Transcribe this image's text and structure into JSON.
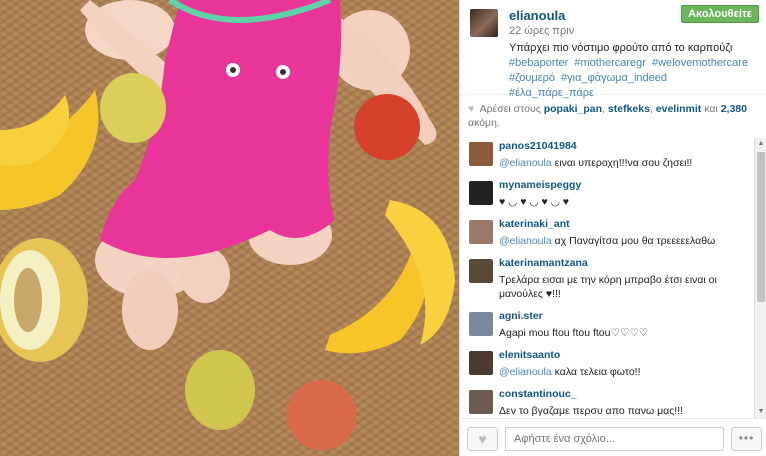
{
  "post": {
    "username": "elianoula",
    "time": "22 ώρες πριν",
    "follow_label": "Ακολουθείτε",
    "caption_text": "Υπάρχει πιο νόστιμο φρούτο από το καρπούζι",
    "hashtags": [
      "#bebaporter",
      "#mothercaregr",
      "#welovemothercare",
      "#ζουμερό",
      "#για_φάγωμα_indeed",
      "#έλα_πάρε_πάρε"
    ]
  },
  "likes": {
    "prefix": "Αρέσει στους",
    "users": [
      "popaki_pan",
      "stefkeks",
      "evelinmit"
    ],
    "and_text": "και",
    "count": "2,380",
    "suffix": "ακόμη."
  },
  "comments": [
    {
      "user": "panos21041984",
      "mention": "@elianoula",
      "text": " ειναι υπεροχη!!!να σου ζησει!!",
      "avatar_color": "#8a5a3a"
    },
    {
      "user": "mynameispeggy",
      "mention": "",
      "text": "♥ ◡ ♥ ◡ ♥ ◡ ♥",
      "avatar_color": "#222222"
    },
    {
      "user": "katerinaki_ant",
      "mention": "@elianoula",
      "text": " αχ Παναγίτσα μου θα τρεεεεελαθω",
      "avatar_color": "#9b7a6a"
    },
    {
      "user": "katerinamantzana",
      "mention": "",
      "text": "Τρελάρα εισαι με την κόρη μπραβο έτσι ειναι οι μανούλες ♥!!!",
      "avatar_color": "#5a4a3a"
    },
    {
      "user": "agni.ster",
      "mention": "",
      "text": "Agapi mou ftou ftou ftou♡♡♡♡",
      "avatar_color": "#7a8a9a"
    },
    {
      "user": "elenitsaanto",
      "mention": "@elianoula",
      "text": " καλα τελεια φωτο!!",
      "avatar_color": "#4a3a30"
    },
    {
      "user": "constantinouc_",
      "mention": "",
      "text": "Δεν το βγαζαμε περσυ απο πανω μας!!!",
      "avatar_color": "#6a5a50"
    }
  ],
  "footer": {
    "comment_placeholder": "Αφήστε ένα σχόλιο...",
    "more_label": "•••"
  }
}
